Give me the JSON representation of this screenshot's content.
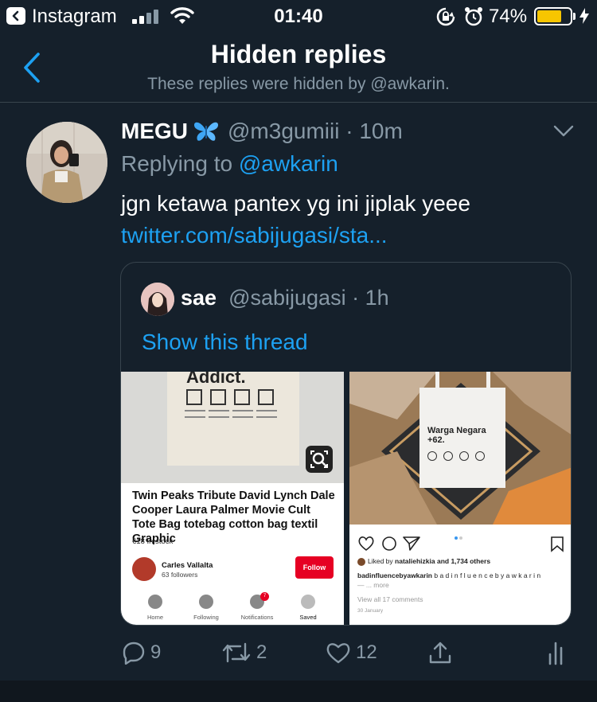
{
  "status_bar": {
    "back_app": "Instagram",
    "time": "01:40",
    "battery_percent": "74%",
    "battery_level": 0.74,
    "battery_color": "#f7c600"
  },
  "header": {
    "title": "Hidden replies",
    "subtitle": "These replies were hidden by @awkarin."
  },
  "tweet": {
    "display_name": "MEGU",
    "handle": "@m3gumiii",
    "time": "10m",
    "replying_prefix": "Replying to",
    "replying_to": "@awkarin",
    "text": "jgn ketawa pantex yg ini jiplak yeee",
    "link": "twitter.com/sabijugasi/sta...",
    "icons": {
      "name_emoji": "butterfly-icon",
      "menu": "chevron-down-icon"
    }
  },
  "quoted_tweet": {
    "display_name": "sae",
    "handle": "@sabijugasi",
    "time": "1h",
    "show_thread": "Show this thread",
    "media_left": {
      "bag_text": "Addict.",
      "title": "Twin Peaks Tribute David Lynch Dale Cooper Laura Palmer Movie Cult Tote Bag totebag cotton bag textil Graphic",
      "price": "€18 In stock",
      "profile_name": "Carles Vallalta",
      "profile_followers": "63 followers",
      "follow_label": "Follow",
      "nav": [
        {
          "label": "Home"
        },
        {
          "label": "Following"
        },
        {
          "label": "Notifications",
          "badge": "7"
        },
        {
          "label": "Saved"
        }
      ]
    },
    "media_right": {
      "bag_text_line1": "Warga Negara",
      "bag_text_line2": "+62.",
      "liked_by_prefix": "Liked by",
      "liked_by_user": "nataliehizkia",
      "liked_by_suffix": "and 1,734 others",
      "caption_user": "badinfluencebyawkarin",
      "caption_text": "b a d i n f l u e n c e b y a w k a r i n",
      "more": "— ... more",
      "view_comments": "View all 17 comments",
      "date": "30 January"
    }
  },
  "actions": {
    "reply_count": "9",
    "retweet_count": "2",
    "like_count": "12"
  },
  "colors": {
    "background": "#15202b",
    "accent": "#1da1f2",
    "secondary_text": "#8899a6",
    "divider": "#38444d"
  }
}
